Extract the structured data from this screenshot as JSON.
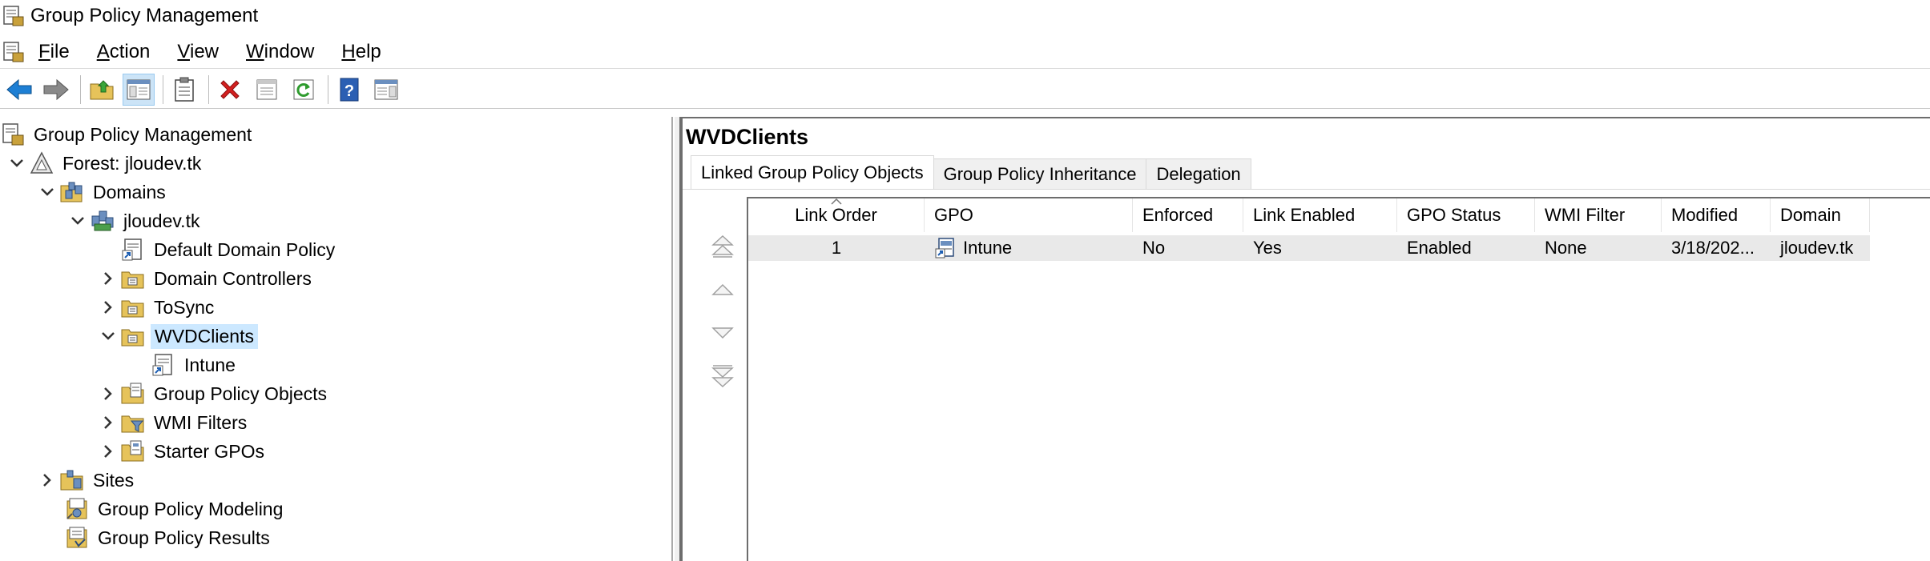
{
  "window": {
    "title": "Group Policy Management"
  },
  "menu": [
    {
      "accel": "F",
      "rest": "ile"
    },
    {
      "accel": "A",
      "rest": "ction"
    },
    {
      "accel": "V",
      "rest": "iew"
    },
    {
      "accel": "W",
      "rest": "indow"
    },
    {
      "accel": "H",
      "rest": "elp"
    }
  ],
  "toolbar": {
    "buttons": [
      "back-arrow-icon",
      "forward-arrow-icon",
      "up-folder-icon",
      "show-hide-tree-icon",
      "clipboard-icon",
      "delete-icon",
      "properties-icon",
      "refresh-icon",
      "help-icon",
      "action-pane-icon"
    ]
  },
  "tree": {
    "root": "Group Policy Management",
    "forest": "Forest: jloudev.tk",
    "domains": "Domains",
    "domain": "jloudev.tk",
    "default_policy": "Default Domain Policy",
    "domain_controllers": "Domain Controllers",
    "tosync": "ToSync",
    "wvdclients": "WVDClients",
    "intune": "Intune",
    "gpo_objects": "Group Policy Objects",
    "wmi_filters": "WMI Filters",
    "starter_gpos": "Starter GPOs",
    "sites": "Sites",
    "modeling": "Group Policy Modeling",
    "results": "Group Policy Results"
  },
  "details": {
    "title": "WVDClients",
    "tabs": [
      "Linked Group Policy Objects",
      "Group Policy Inheritance",
      "Delegation"
    ],
    "columns": [
      "Link Order",
      "GPO",
      "Enforced",
      "Link Enabled",
      "GPO Status",
      "WMI Filter",
      "Modified",
      "Domain"
    ],
    "rows": [
      {
        "link_order": "1",
        "gpo": "Intune",
        "enforced": "No",
        "link_enabled": "Yes",
        "gpo_status": "Enabled",
        "wmi_filter": "None",
        "modified": "3/18/202...",
        "domain": "jloudev.tk"
      }
    ]
  },
  "colors": {
    "selection": "#cce8ff",
    "row_highlight": "#e9e9e9",
    "back_arrow": "#1e7fd4",
    "delete_red": "#d42020",
    "help_blue": "#2b5fb3"
  }
}
